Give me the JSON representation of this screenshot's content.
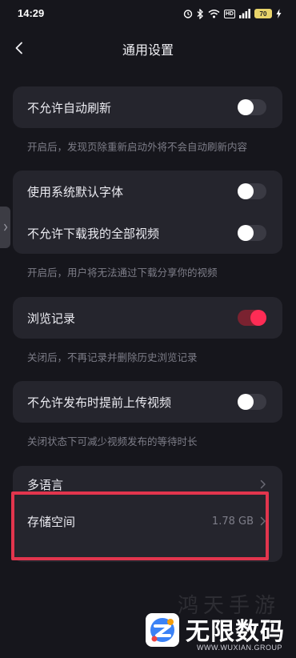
{
  "status_bar": {
    "time": "14:29",
    "hd_label": "HD",
    "battery": "70",
    "icons": [
      "alarm-icon",
      "bluetooth-icon",
      "wifi-icon",
      "signal-icon",
      "battery-icon",
      "charging-icon"
    ]
  },
  "header": {
    "title": "通用设置",
    "back_icon": "chevron-left-icon"
  },
  "settings": {
    "auto_refresh": {
      "label": "不允许自动刷新",
      "enabled": false,
      "caption": "开启后，发现页除重新启动外将不会自动刷新内容"
    },
    "system_font": {
      "label": "使用系统默认字体",
      "enabled": false
    },
    "no_download": {
      "label": "不允许下载我的全部视频",
      "enabled": false,
      "caption": "开启后，用户将无法通过下载分享你的视频"
    },
    "browse_history": {
      "label": "浏览记录",
      "enabled": true,
      "caption": "关闭后，不再记录并删除历史浏览记录"
    },
    "pre_upload": {
      "label": "不允许发布时提前上传视频",
      "enabled": false,
      "caption": "关闭状态下可减少视频发布的等待时长"
    },
    "language": {
      "label": "多语言"
    },
    "storage": {
      "label": "存储空间",
      "value": "1.78 GB"
    }
  },
  "colors": {
    "background": "#16161c",
    "card": "#25252d",
    "accent": "#fe2c55",
    "highlight": "#e2354d",
    "caption": "#7d7d88"
  },
  "watermark": {
    "faint_text": "鸿天手游",
    "title": "无限数码",
    "url": "WWW.WUXIAN.GROUP"
  }
}
